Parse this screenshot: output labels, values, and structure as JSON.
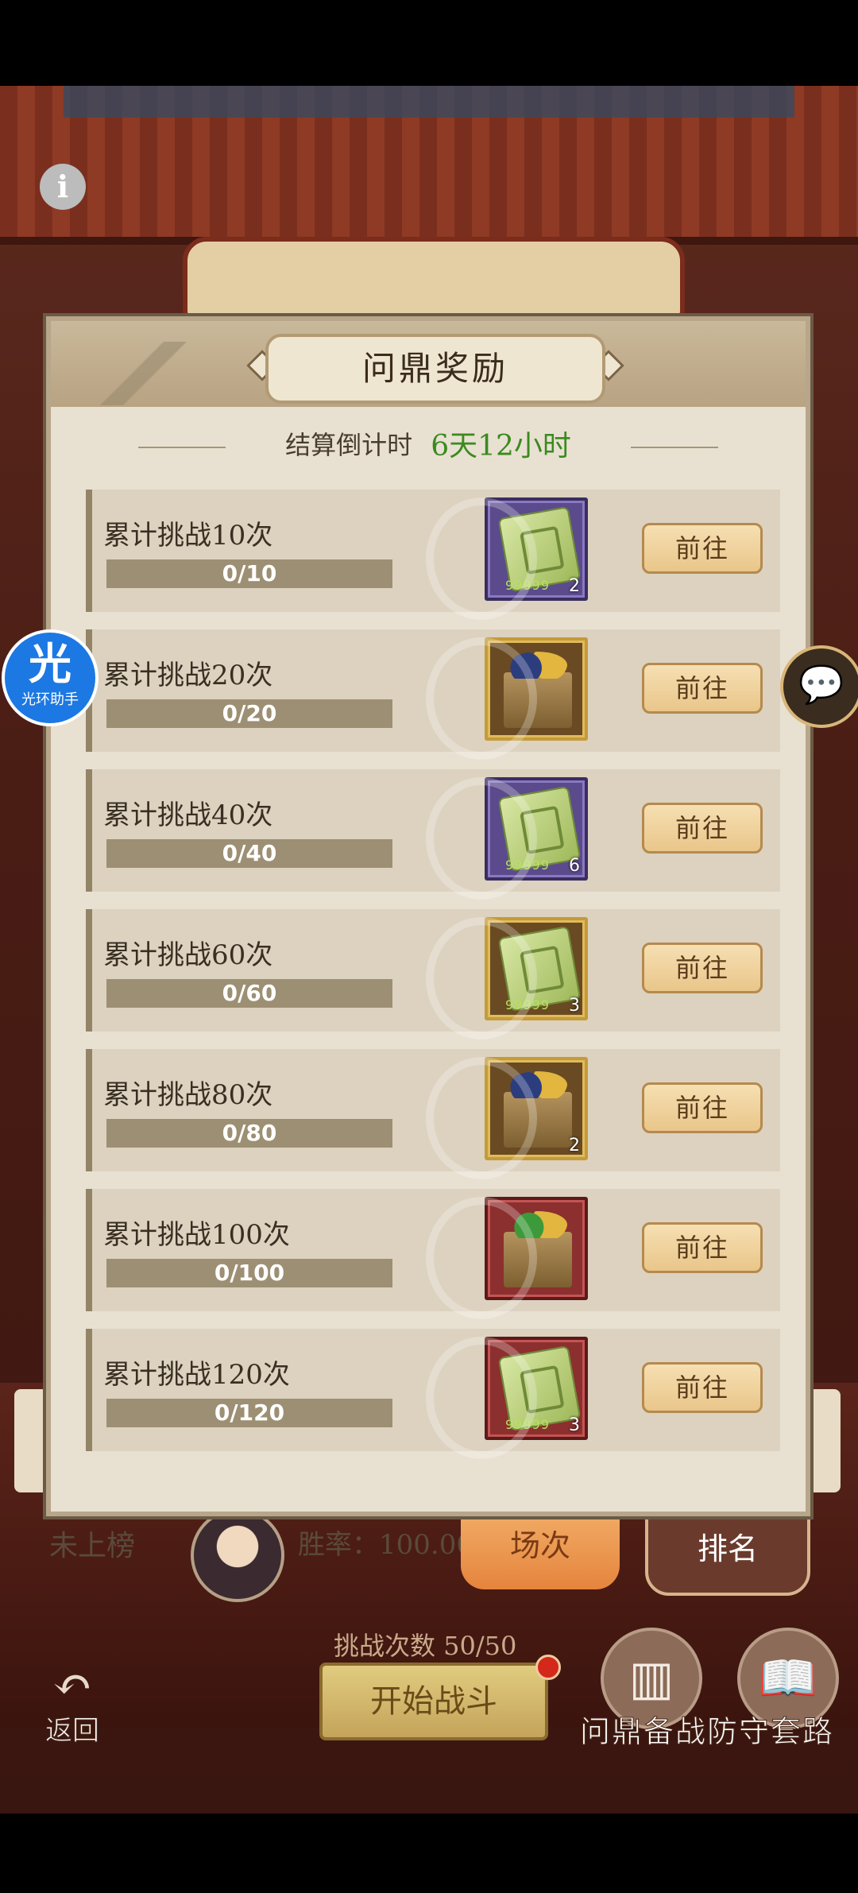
{
  "background": {
    "info_icon": "i",
    "rank_status": "未上榜",
    "win_rate": "胜率：100.00",
    "tabs": {
      "order": "场次",
      "rank": "排名"
    },
    "challenge_count": "挑战次数 50/50",
    "back_label": "返回",
    "back_icon": "back-arrow-icon",
    "start_button": "开始战斗",
    "bottom_caption": "问鼎备战防守套路"
  },
  "helper": {
    "glyph": "光",
    "label": "光环助手"
  },
  "chat_icon": "💬",
  "modal": {
    "title": "问鼎奖励",
    "countdown_label": "结算倒计时",
    "countdown_value": "6天12小时",
    "goto_label": "前往",
    "rows": [
      {
        "title": "累计挑战10次",
        "progress": "0/10",
        "progress_fraction": 0,
        "item": "jade-token",
        "rarity": "purple",
        "count": "2",
        "dots": "99999"
      },
      {
        "title": "累计挑战20次",
        "progress": "0/20",
        "progress_fraction": 0,
        "item": "treasure-box",
        "rarity": "gold",
        "count": "",
        "dots": ""
      },
      {
        "title": "累计挑战40次",
        "progress": "0/40",
        "progress_fraction": 0,
        "item": "jade-token",
        "rarity": "purple",
        "count": "6",
        "dots": "99999"
      },
      {
        "title": "累计挑战60次",
        "progress": "0/60",
        "progress_fraction": 0,
        "item": "jade-token",
        "rarity": "gold",
        "count": "3",
        "dots": "99999"
      },
      {
        "title": "累计挑战80次",
        "progress": "0/80",
        "progress_fraction": 0,
        "item": "treasure-box",
        "rarity": "gold",
        "count": "2",
        "dots": ""
      },
      {
        "title": "累计挑战100次",
        "progress": "0/100",
        "progress_fraction": 0,
        "item": "treasure-box-green",
        "rarity": "red",
        "count": "",
        "dots": ""
      },
      {
        "title": "累计挑战120次",
        "progress": "0/120",
        "progress_fraction": 0,
        "item": "jade-token",
        "rarity": "red",
        "count": "3",
        "dots": "99999"
      }
    ]
  }
}
